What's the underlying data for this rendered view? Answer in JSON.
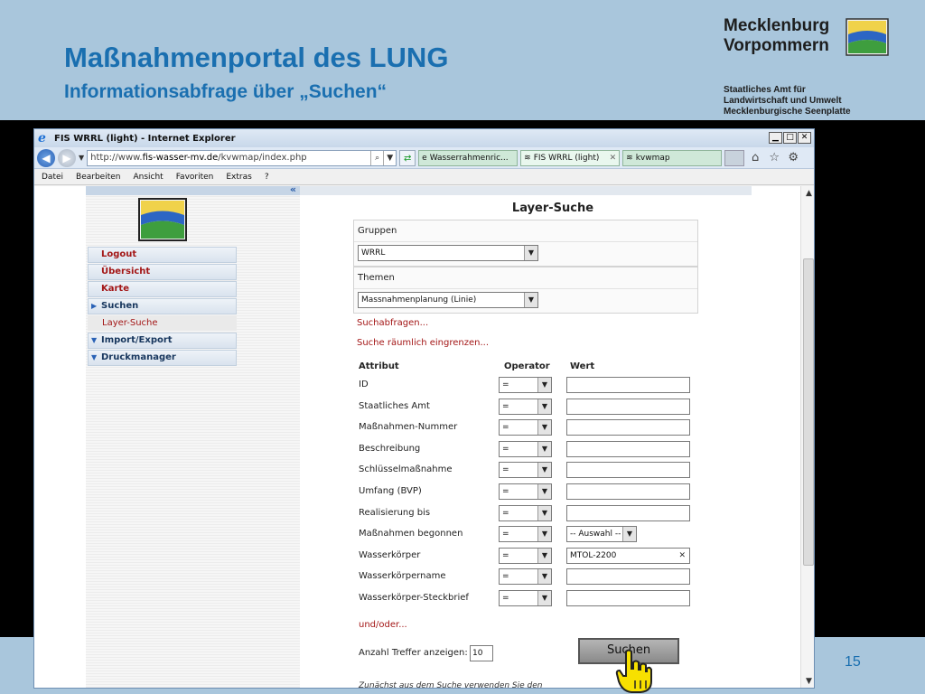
{
  "slide": {
    "title": "Maßnahmenportal des LUNG",
    "subtitle": "Informationsabfrage über „Suchen“",
    "brand_line1": "Mecklenburg",
    "brand_line2": "Vorpommern",
    "org_line1": "Staatliches Amt für",
    "org_line2": "Landwirtschaft und Umwelt",
    "org_line3": "Mecklenburgische Seenplatte",
    "number": "15"
  },
  "browser": {
    "window_title": "FIS WRRL (light) - Internet Explorer",
    "url_prefix": "http://www.",
    "url_domain": "fis-wasser-mv.de",
    "url_path": "/kvwmap/index.php",
    "tabs": [
      {
        "label": "Wasserrahmenric...",
        "active": false
      },
      {
        "label": "FIS WRRL (light)",
        "active": true
      },
      {
        "label": "kvwmap",
        "active": false
      }
    ],
    "menu": [
      "Datei",
      "Bearbeiten",
      "Ansicht",
      "Favoriten",
      "Extras",
      "?"
    ],
    "icons": [
      "back-arrow-icon",
      "forward-arrow-icon",
      "home-icon",
      "star-icon",
      "gear-icon"
    ]
  },
  "sidebar": {
    "items": [
      {
        "label": "Logout",
        "type": "link"
      },
      {
        "label": "Übersicht",
        "type": "link"
      },
      {
        "label": "Karte",
        "type": "link"
      },
      {
        "label": "Suchen",
        "type": "expanded"
      },
      {
        "label": "Layer-Suche",
        "type": "sub"
      },
      {
        "label": "Import/Export",
        "type": "collapsed"
      },
      {
        "label": "Druckmanager",
        "type": "collapsed"
      }
    ]
  },
  "form": {
    "title": "Layer-Suche",
    "groups_label": "Gruppen",
    "groups_value": "WRRL",
    "themes_label": "Themen",
    "themes_value": "Massnahmenplanung (Linie)",
    "link_queries": "Suchabfragen...",
    "link_spatial": "Suche räumlich eingrenzen...",
    "col_attribute": "Attribut",
    "col_operator": "Operator",
    "col_value": "Wert",
    "rows": [
      {
        "label": "ID",
        "op": "=",
        "value": "",
        "kind": "text"
      },
      {
        "label": "Staatliches Amt",
        "op": "=",
        "value": "",
        "kind": "text"
      },
      {
        "label": "Maßnahmen-Nummer",
        "op": "=",
        "value": "",
        "kind": "text"
      },
      {
        "label": "Beschreibung",
        "op": "=",
        "value": "",
        "kind": "text"
      },
      {
        "label": "Schlüsselmaßnahme",
        "op": "=",
        "value": "",
        "kind": "text"
      },
      {
        "label": "Umfang (BVP)",
        "op": "=",
        "value": "",
        "kind": "text"
      },
      {
        "label": "Realisierung bis",
        "op": "=",
        "value": "",
        "kind": "text"
      },
      {
        "label": "Maßnahmen begonnen",
        "op": "=",
        "value": "-- Auswahl --",
        "kind": "select"
      },
      {
        "label": "Wasserkörper",
        "op": "=",
        "value": "MTOL-2200",
        "kind": "text-clear"
      },
      {
        "label": "Wasserkörpername",
        "op": "=",
        "value": "",
        "kind": "text"
      },
      {
        "label": "Wasserkörper-Steckbrief",
        "op": "=",
        "value": "",
        "kind": "text"
      }
    ],
    "link_andor": "und/oder...",
    "hits_label": "Anzahl Treffer anzeigen:",
    "hits_value": "10",
    "search_button": "Suchen",
    "hint_text": "Zunächst aus dem Suche verwenden Sie den"
  },
  "colors": {
    "accent": "#1a6fb0",
    "link": "#a31616",
    "background": "#a9c6dc"
  }
}
